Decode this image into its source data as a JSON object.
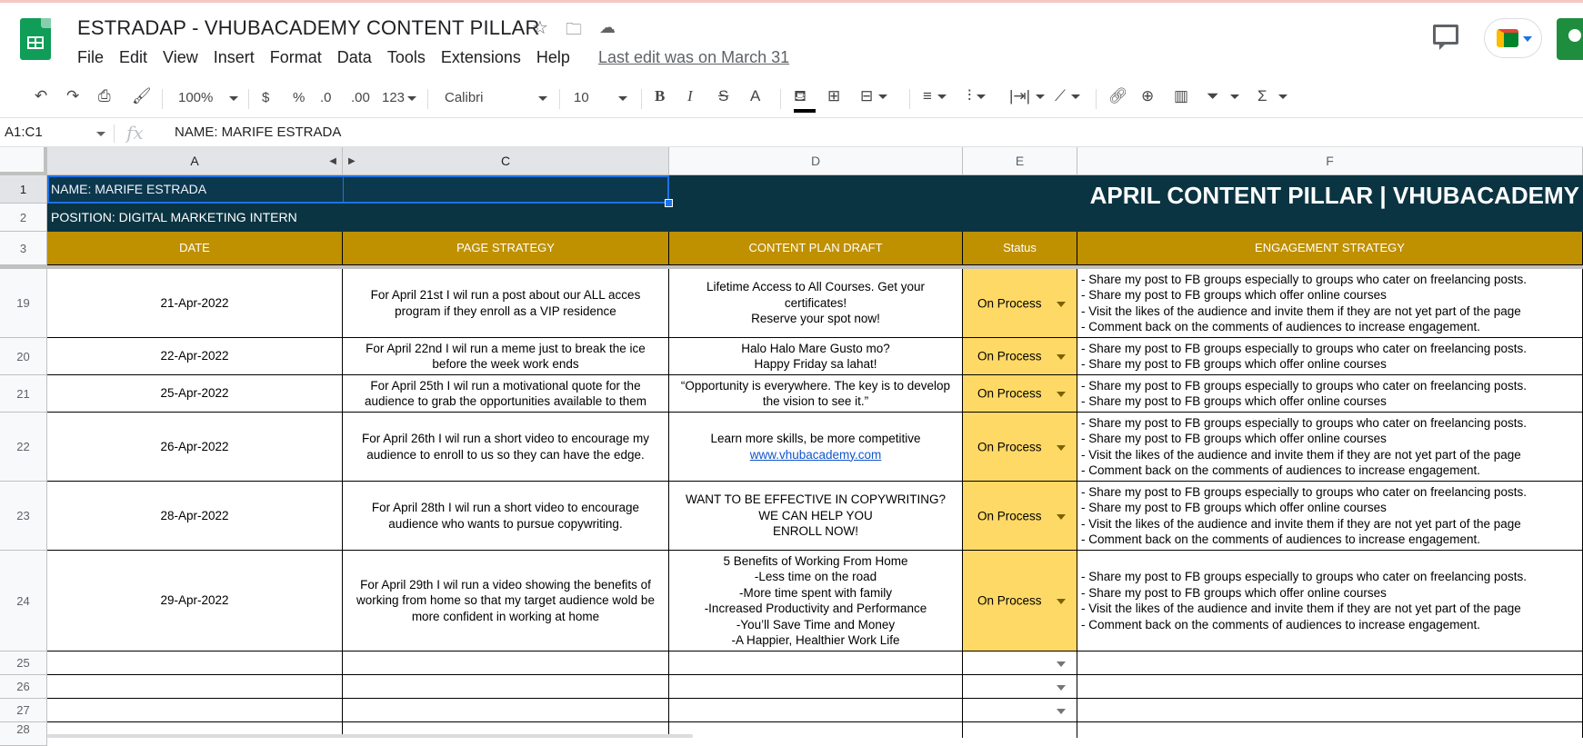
{
  "app": {
    "doc_title": "ESTRADAP - VHUBACADEMY CONTENT PILLAR",
    "title_icons": [
      "star-icon",
      "move-folder-icon",
      "cloud-status-icon"
    ],
    "menu": [
      "File",
      "Edit",
      "View",
      "Insert",
      "Format",
      "Data",
      "Tools",
      "Extensions",
      "Help"
    ],
    "last_edit": "Last edit was on March 31"
  },
  "toolbar": {
    "zoom": "100%",
    "currency": "$",
    "percent": "%",
    "dec_decrease": ".0",
    "dec_increase": ".00",
    "number_format": "123",
    "font": "Calibri",
    "font_size": "10",
    "bold": "B",
    "italic": "I",
    "strike": "S",
    "text_color": "A"
  },
  "formula_bar": {
    "name_box": "A1:C1",
    "fx": "fx",
    "content": "NAME: MARIFE ESTRADA"
  },
  "columns": [
    "A",
    "C",
    "D",
    "E",
    "F"
  ],
  "header_rows": {
    "r1": "1",
    "r2": "2",
    "r3": "3",
    "name": "NAME: MARIFE ESTRADA",
    "position": "POSITION: DIGITAL MARKETING INTERN",
    "banner": "APRIL CONTENT PILLAR | VHUBACADEMY",
    "col_date": "DATE",
    "col_strategy": "PAGE STRATEGY",
    "col_draft": "CONTENT PLAN DRAFT",
    "col_status": "Status",
    "col_engagement": "ENGAGEMENT STRATEGY"
  },
  "rows": [
    {
      "num": "19",
      "date": "21-Apr-2022",
      "strategy": "For April 21st I wil run a post about our ALL acces program if they enroll as a VIP residence",
      "draft": [
        "Lifetime Access to All Courses. Get your certificates!",
        "Reserve your spot now!"
      ],
      "status": "On Process",
      "engagement": [
        "- Share my post to FB groups especially to groups who cater on freelancing posts.",
        "- Share my post to FB groups which offer online courses",
        "- Visit the likes of the audience and invite them if they are not yet part of the page",
        "- Comment back on the comments of audiences to increase engagement."
      ]
    },
    {
      "num": "20",
      "date": "22-Apr-2022",
      "strategy": "For April 22nd I wil run a meme just to break the ice before the week work ends",
      "draft": [
        "Halo Halo Mare Gusto mo?",
        "Happy Friday sa lahat!"
      ],
      "status": "On Process",
      "engagement": [
        "- Share my post to FB groups especially to groups who cater on freelancing posts.",
        "- Share my post to FB groups which offer online courses"
      ]
    },
    {
      "num": "21",
      "date": "25-Apr-2022",
      "strategy": "For April 25th I wil run a motivational quote for the audience to grab the opportunities available to them",
      "draft": [
        "“Opportunity is everywhere. The key is to develop the vision to see it.”"
      ],
      "status": "On Process",
      "engagement": [
        "- Share my post to FB groups especially to groups who cater on freelancing posts.",
        "- Share my post to FB groups which offer online courses"
      ]
    },
    {
      "num": "22",
      "date": "26-Apr-2022",
      "strategy": "For April 26th I wil run a short video to encourage my audience to enroll to us so they can have the edge.",
      "draft": [
        "Learn more skills, be more competitive"
      ],
      "draft_link": "www.vhubacademy.com",
      "status": "On Process",
      "engagement": [
        "- Share my post to FB groups especially to groups who cater on freelancing posts.",
        "- Share my post to FB groups which offer online courses",
        "- Visit the likes of the audience and invite them if they are not yet part of the page",
        "- Comment back on the comments of audiences to increase engagement."
      ]
    },
    {
      "num": "23",
      "date": "28-Apr-2022",
      "strategy": "For April 28th I wil run a short video to encourage audience who wants to pursue copywriting.",
      "draft": [
        "WANT TO BE EFFECTIVE IN COPYWRITING?",
        "WE CAN HELP YOU",
        "ENROLL NOW!"
      ],
      "status": "On Process",
      "engagement": [
        "- Share my post to FB groups especially to groups who cater on freelancing posts.",
        "- Share my post to FB groups which offer online courses",
        "- Visit the likes of the audience and invite them if they are not yet part of the page",
        "- Comment back on the comments of audiences to increase engagement."
      ]
    },
    {
      "num": "24",
      "date": "29-Apr-2022",
      "strategy": "For April 29th I wil run a video showing the benefits of working from home so that my target audience wold be more confident in working at home",
      "draft": [
        "5 Benefits of Working From Home",
        "-Less time on the road",
        "-More time spent with family",
        "-Increased Productivity and Performance",
        "-You’ll Save Time and Money",
        "-A Happier, Healthier Work Life"
      ],
      "status": "On Process",
      "engagement": [
        "- Share my post to FB groups especially to groups who cater on freelancing posts.",
        "- Share my post to FB groups which offer online courses",
        "- Visit the likes of the audience and invite them if they are not yet part of the page",
        "- Comment back on the comments of audiences to increase engagement."
      ]
    }
  ],
  "empty_rows": [
    "25",
    "26",
    "27",
    "28"
  ],
  "colors": {
    "navy": "#0b3442",
    "gold": "#bf9000",
    "status_fill": "#ffd966",
    "selection": "#1a73e8"
  }
}
